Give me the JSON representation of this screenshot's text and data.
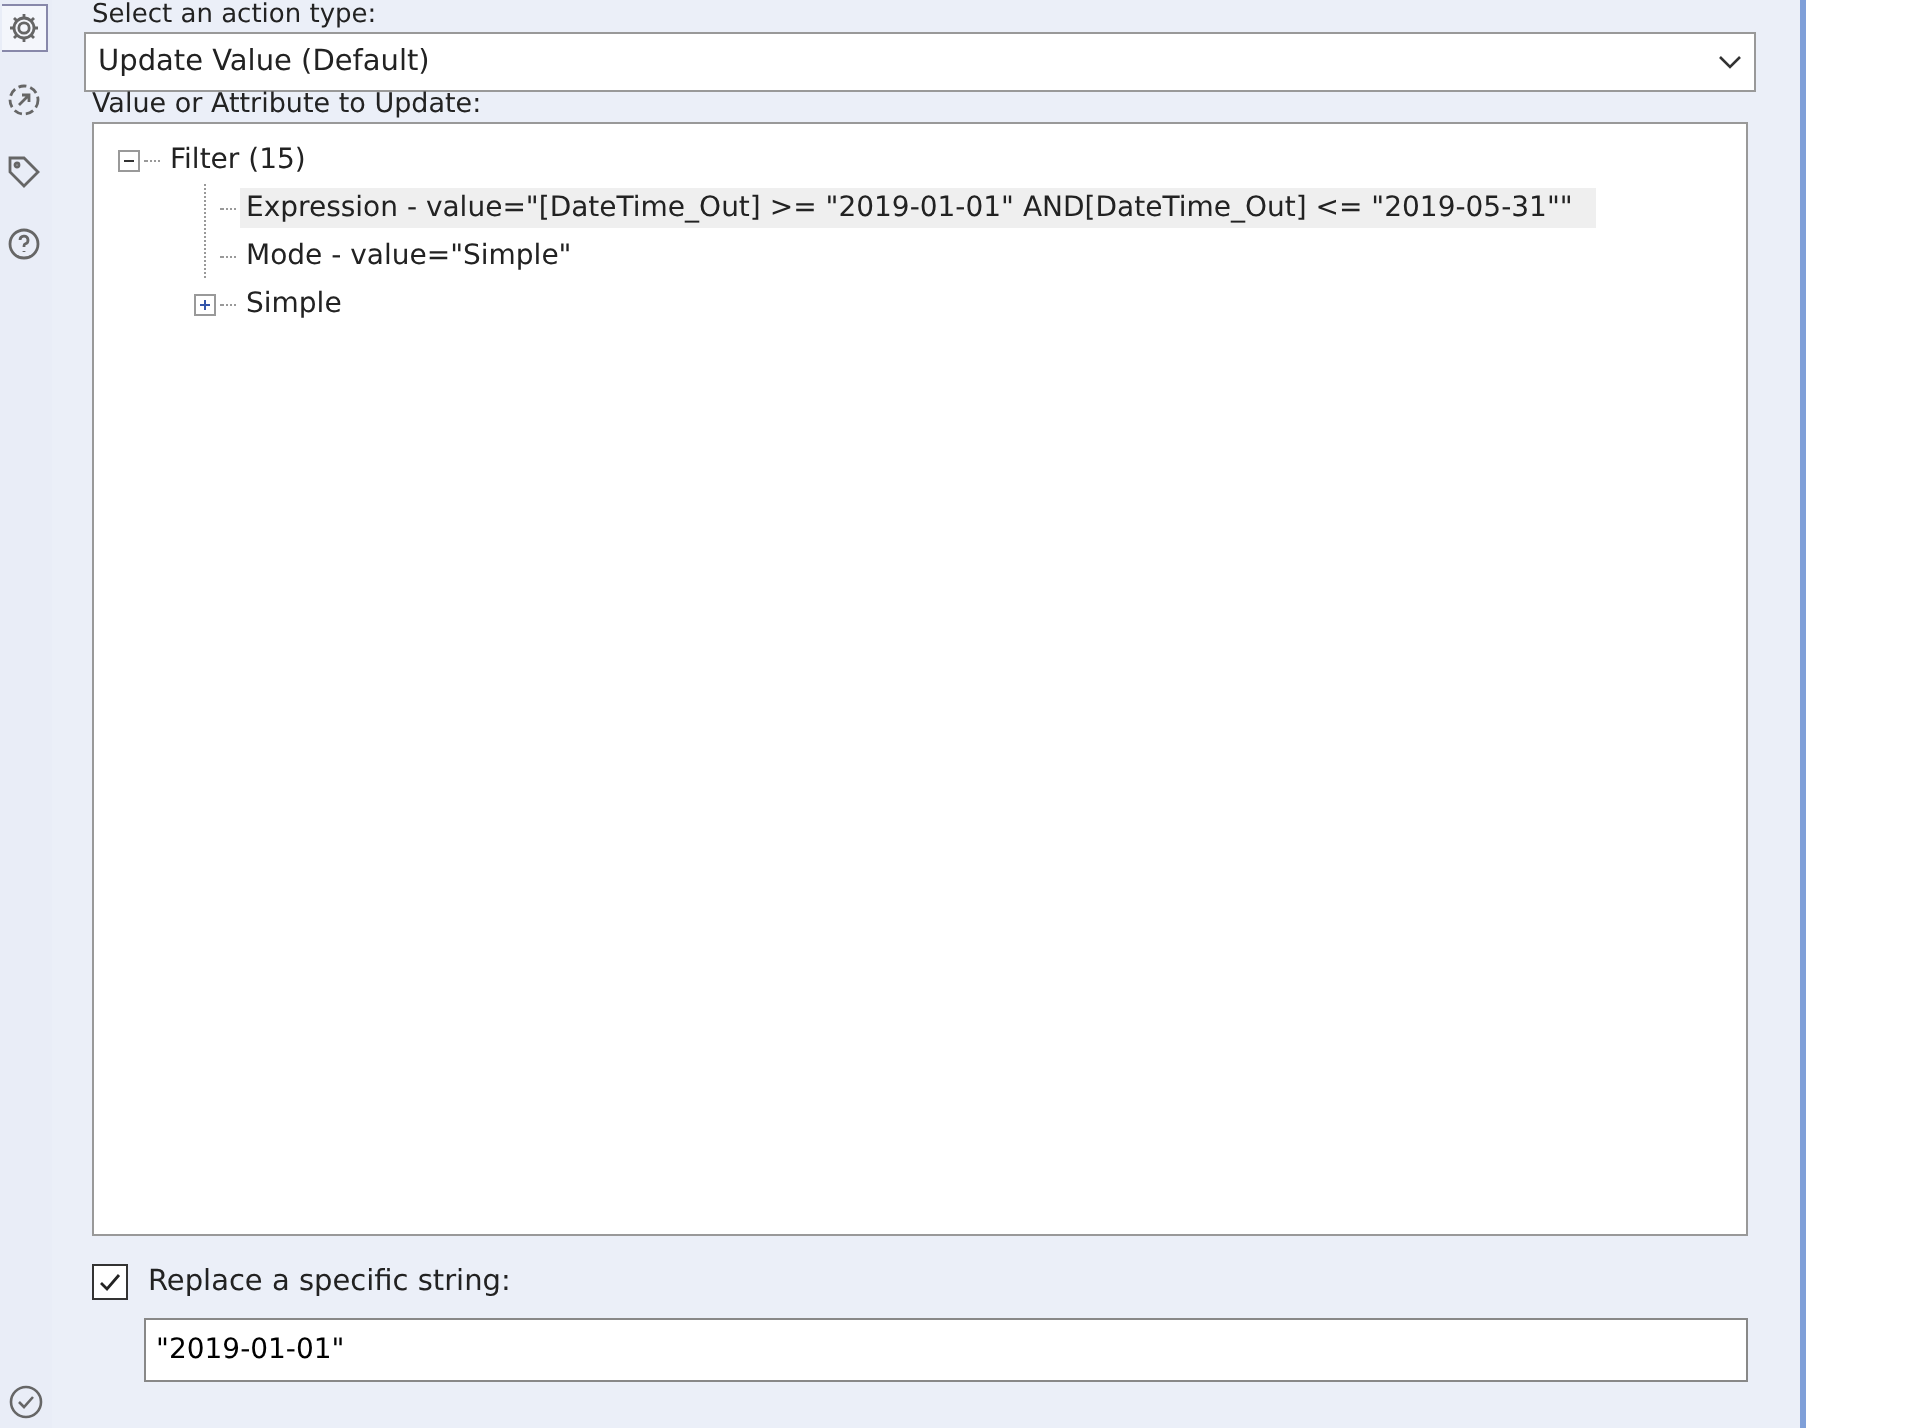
{
  "sidebar": {
    "icons": [
      {
        "kind": "gear",
        "selected": true
      },
      {
        "kind": "arrow",
        "selected": false
      },
      {
        "kind": "tag",
        "selected": false
      },
      {
        "kind": "help",
        "selected": false
      }
    ]
  },
  "action_type": {
    "label": "Select an action type:",
    "value": "Update Value (Default)"
  },
  "tree": {
    "label": "Value or Attribute to Update:",
    "items": [
      {
        "label": "Filter (15)",
        "expanded": true,
        "selected": false,
        "children": [
          {
            "label": "Expression - value=\"[DateTime_Out] >= \"2019-01-01\" AND[DateTime_Out] <= \"2019-05-31\"\"",
            "selected": true
          },
          {
            "label": "Mode - value=\"Simple\"",
            "selected": false
          },
          {
            "label": "Simple",
            "expanded": false,
            "selected": false
          }
        ]
      }
    ]
  },
  "replace": {
    "label": "Replace a specific string:",
    "checked": true,
    "value": "\"2019-01-01\""
  }
}
